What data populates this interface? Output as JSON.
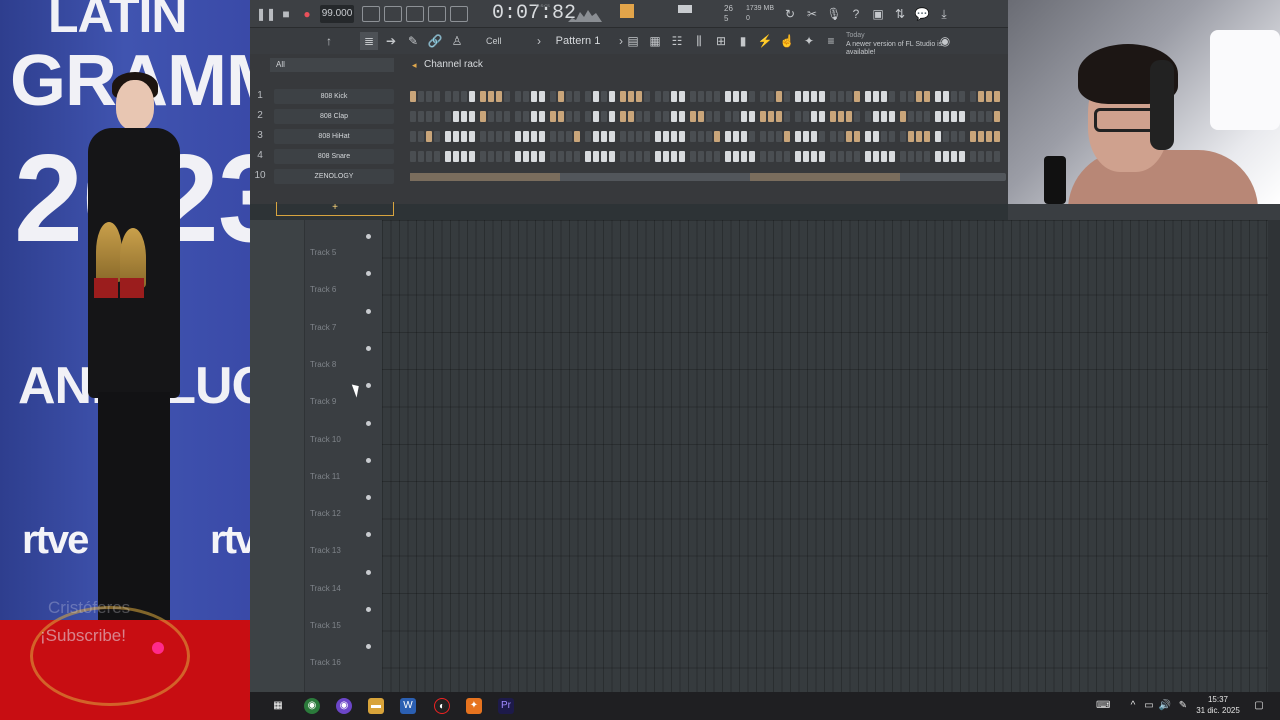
{
  "overlay": {
    "title_line1": "LATIN",
    "title_line2": "GRAMMY",
    "year": "2023",
    "region": "ANDALUCÍA",
    "sponsor_left": "rtve",
    "sponsor_right": "rtve",
    "subscribe_line1": "Cristóferes",
    "subscribe_line2": "¡Subscribe!"
  },
  "transport": {
    "tempo": "99.000",
    "time": "0:07:82",
    "time_unit": "M:S:CS",
    "cpu": "26",
    "cpu_sub": "5",
    "memory": "1739 MB",
    "memory_sub": "0"
  },
  "toolbar": {
    "snap": "Cell",
    "pattern": "Pattern 1",
    "news_date": "Today",
    "news_text": "A newer version of FL Studio is available!"
  },
  "channel_rack": {
    "filter": "All",
    "title": "Channel rack",
    "add_label": "+",
    "channels": [
      {
        "num": "1",
        "name": "808 Kick"
      },
      {
        "num": "2",
        "name": "808 Clap"
      },
      {
        "num": "3",
        "name": "808 HiHat"
      },
      {
        "num": "4",
        "name": "808 Snare"
      },
      {
        "num": "10",
        "name": "ZENOLOGY"
      }
    ]
  },
  "playlist": {
    "tracks": [
      "Track 5",
      "Track 6",
      "Track 7",
      "Track 8",
      "Track 9",
      "Track 10",
      "Track 11",
      "Track 12",
      "Track 13",
      "Track 14",
      "Track 15",
      "Track 16"
    ]
  },
  "taskbar": {
    "time": "15:37",
    "date": "31 dic. 2025"
  }
}
